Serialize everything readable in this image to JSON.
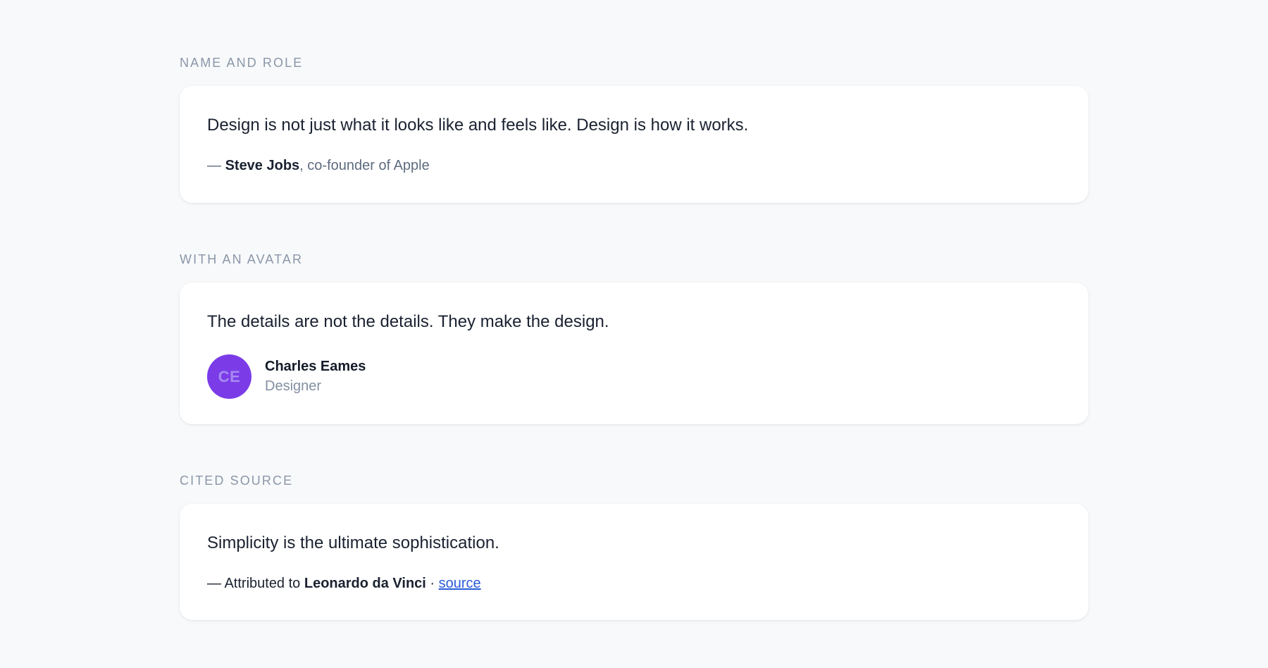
{
  "sections": [
    {
      "label": "NAME AND ROLE",
      "quote": "Design is not just what it looks like and feels like. Design is how it works.",
      "dash": "— ",
      "author": "Steve Jobs",
      "role_suffix": ", co-founder of Apple"
    },
    {
      "label": "WITH AN AVATAR",
      "quote": "The details are not the details. They make the design.",
      "avatar_initials": "CE",
      "avatar_color": "#7b3ce8",
      "author": "Charles Eames",
      "role": "Designer"
    },
    {
      "label": "CITED SOURCE",
      "quote": "Simplicity is the ultimate sophistication.",
      "prefix": "— Attributed to ",
      "author": "Leonardo da Vinci",
      "separator": " · ",
      "source_link": "source"
    }
  ]
}
